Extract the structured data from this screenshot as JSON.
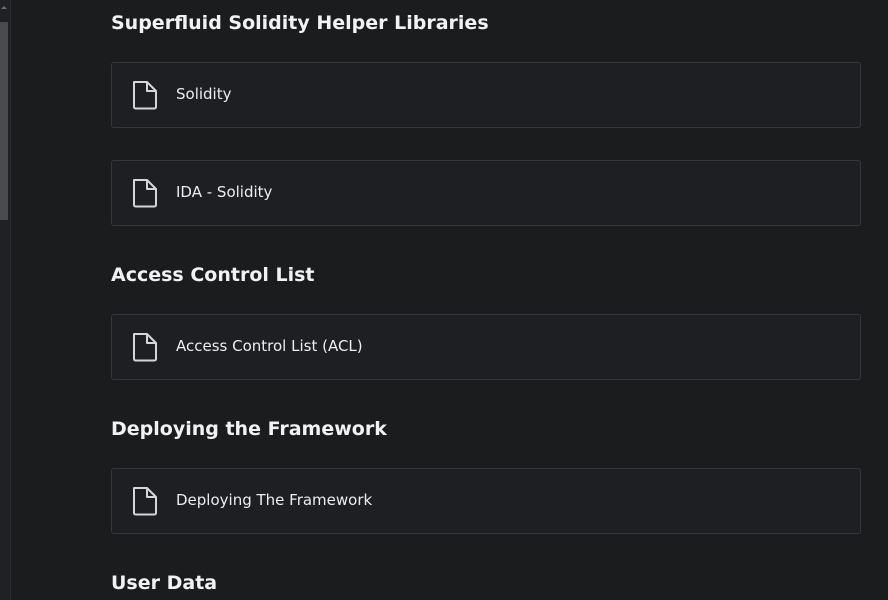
{
  "sections": [
    {
      "title": "Superfluid Solidity Helper Libraries",
      "items": [
        {
          "label": "Solidity",
          "icon": "document-icon"
        },
        {
          "label": "IDA - Solidity",
          "icon": "document-icon"
        }
      ]
    },
    {
      "title": "Access Control List",
      "items": [
        {
          "label": "Access Control List (ACL)",
          "icon": "document-icon"
        }
      ]
    },
    {
      "title": "Deploying the Framework",
      "items": [
        {
          "label": "Deploying The Framework",
          "icon": "document-icon"
        }
      ]
    },
    {
      "title": "User Data",
      "items": []
    }
  ],
  "colors": {
    "background": "#1b1c1e",
    "card_border": "#36373b",
    "text": "#ededf0"
  }
}
